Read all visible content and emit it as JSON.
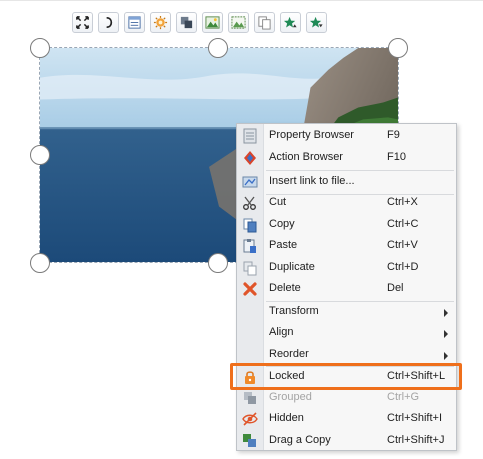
{
  "toolbar": {
    "buttons": [
      {
        "icon": "fit-to-frame-icon"
      },
      {
        "icon": "bracket-icon"
      },
      {
        "icon": "document-panel-icon"
      },
      {
        "icon": "settings-burst-icon"
      },
      {
        "icon": "layers-icon"
      },
      {
        "icon": "picture-icon"
      },
      {
        "icon": "picture-dotted-icon"
      },
      {
        "icon": "copy-pages-icon"
      },
      {
        "icon": "star-up-icon"
      },
      {
        "icon": "star-down-icon"
      }
    ]
  },
  "context_menu": {
    "items": [
      {
        "label": "Property Browser",
        "shortcut": "F9",
        "icon": "property-browser-icon"
      },
      {
        "label": "Action Browser",
        "shortcut": "F10",
        "icon": "action-browser-icon"
      },
      {
        "label": "Insert link to file...",
        "shortcut": "",
        "icon": "insert-link-icon"
      },
      {
        "label": "Cut",
        "shortcut": "Ctrl+X",
        "icon": "scissors-icon"
      },
      {
        "label": "Copy",
        "shortcut": "Ctrl+C",
        "icon": "copy-icon"
      },
      {
        "label": "Paste",
        "shortcut": "Ctrl+V",
        "icon": "paste-icon"
      },
      {
        "label": "Duplicate",
        "shortcut": "Ctrl+D",
        "icon": "duplicate-icon"
      },
      {
        "label": "Delete",
        "shortcut": "Del",
        "icon": "delete-x-icon"
      },
      {
        "label": "Transform",
        "shortcut": "",
        "icon": "",
        "submenu": true
      },
      {
        "label": "Align",
        "shortcut": "",
        "icon": "",
        "submenu": true
      },
      {
        "label": "Reorder",
        "shortcut": "",
        "icon": "",
        "submenu": true
      },
      {
        "label": "Locked",
        "shortcut": "Ctrl+Shift+L",
        "icon": "lock-icon"
      },
      {
        "label": "Grouped",
        "shortcut": "Ctrl+G",
        "icon": "group-icon",
        "disabled": true
      },
      {
        "label": "Hidden",
        "shortcut": "Ctrl+Shift+I",
        "icon": "hidden-eye-icon"
      },
      {
        "label": "Drag a Copy",
        "shortcut": "Ctrl+Shift+J",
        "icon": "drag-copy-icon"
      }
    ],
    "highlighted_item": "Locked"
  },
  "colors": {
    "highlight": "#ef6f1b",
    "menu_background": "#f7f7f7",
    "disabled_text": "#a4a4a4"
  }
}
